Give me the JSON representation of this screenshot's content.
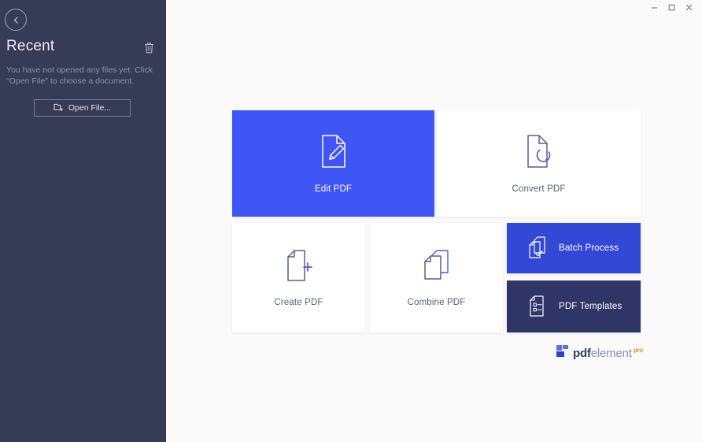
{
  "window": {
    "controls": [
      {
        "name": "minimize",
        "glyph": "–"
      },
      {
        "name": "maximize",
        "glyph": "□"
      },
      {
        "name": "close",
        "glyph": "✕"
      }
    ]
  },
  "sidebar": {
    "back_button_icon": "chevron-left-icon",
    "title": "Recent",
    "clear_icon": "trash-icon",
    "empty_message": "You have not opened any files yet. Click \"Open File\" to choose a document.",
    "open_file_button": {
      "label": "Open File...",
      "icon": "folder-plus-icon"
    }
  },
  "main": {
    "tiles": [
      {
        "id": "edit",
        "label": "Edit PDF",
        "icon": "document-pencil-icon",
        "bg": "#4055f5",
        "fg": "#ffffff",
        "layout": "vertical"
      },
      {
        "id": "convert",
        "label": "Convert PDF",
        "icon": "document-refresh-icon",
        "bg": "#ffffff",
        "fg": "#5c6071",
        "layout": "vertical"
      },
      {
        "id": "create",
        "label": "Create PDF",
        "icon": "document-plus-icon",
        "bg": "#ffffff",
        "fg": "#5c6071",
        "layout": "vertical"
      },
      {
        "id": "combine",
        "label": "Combine PDF",
        "icon": "documents-stack-icon",
        "bg": "#ffffff",
        "fg": "#5c6071",
        "layout": "vertical"
      },
      {
        "id": "batch",
        "label": "Batch Process",
        "icon": "document-check-icon",
        "bg": "#3349d6",
        "fg": "#ffffff",
        "layout": "horizontal"
      },
      {
        "id": "templates",
        "label": "PDF Templates",
        "icon": "document-list-icon",
        "bg": "#2f3566",
        "fg": "#ffffff",
        "layout": "horizontal"
      }
    ]
  },
  "brand": {
    "mark_icon": "pdfelement-logo-icon",
    "name_bold": "pdf",
    "name_light": "element",
    "edition": "pro"
  },
  "colors": {
    "sidebar_bg": "#373c56",
    "main_bg": "#fafafa",
    "accent_blue": "#4055f5",
    "deep_blue": "#3349d6",
    "navy": "#2f3566",
    "brand_orange": "#f08a28"
  }
}
